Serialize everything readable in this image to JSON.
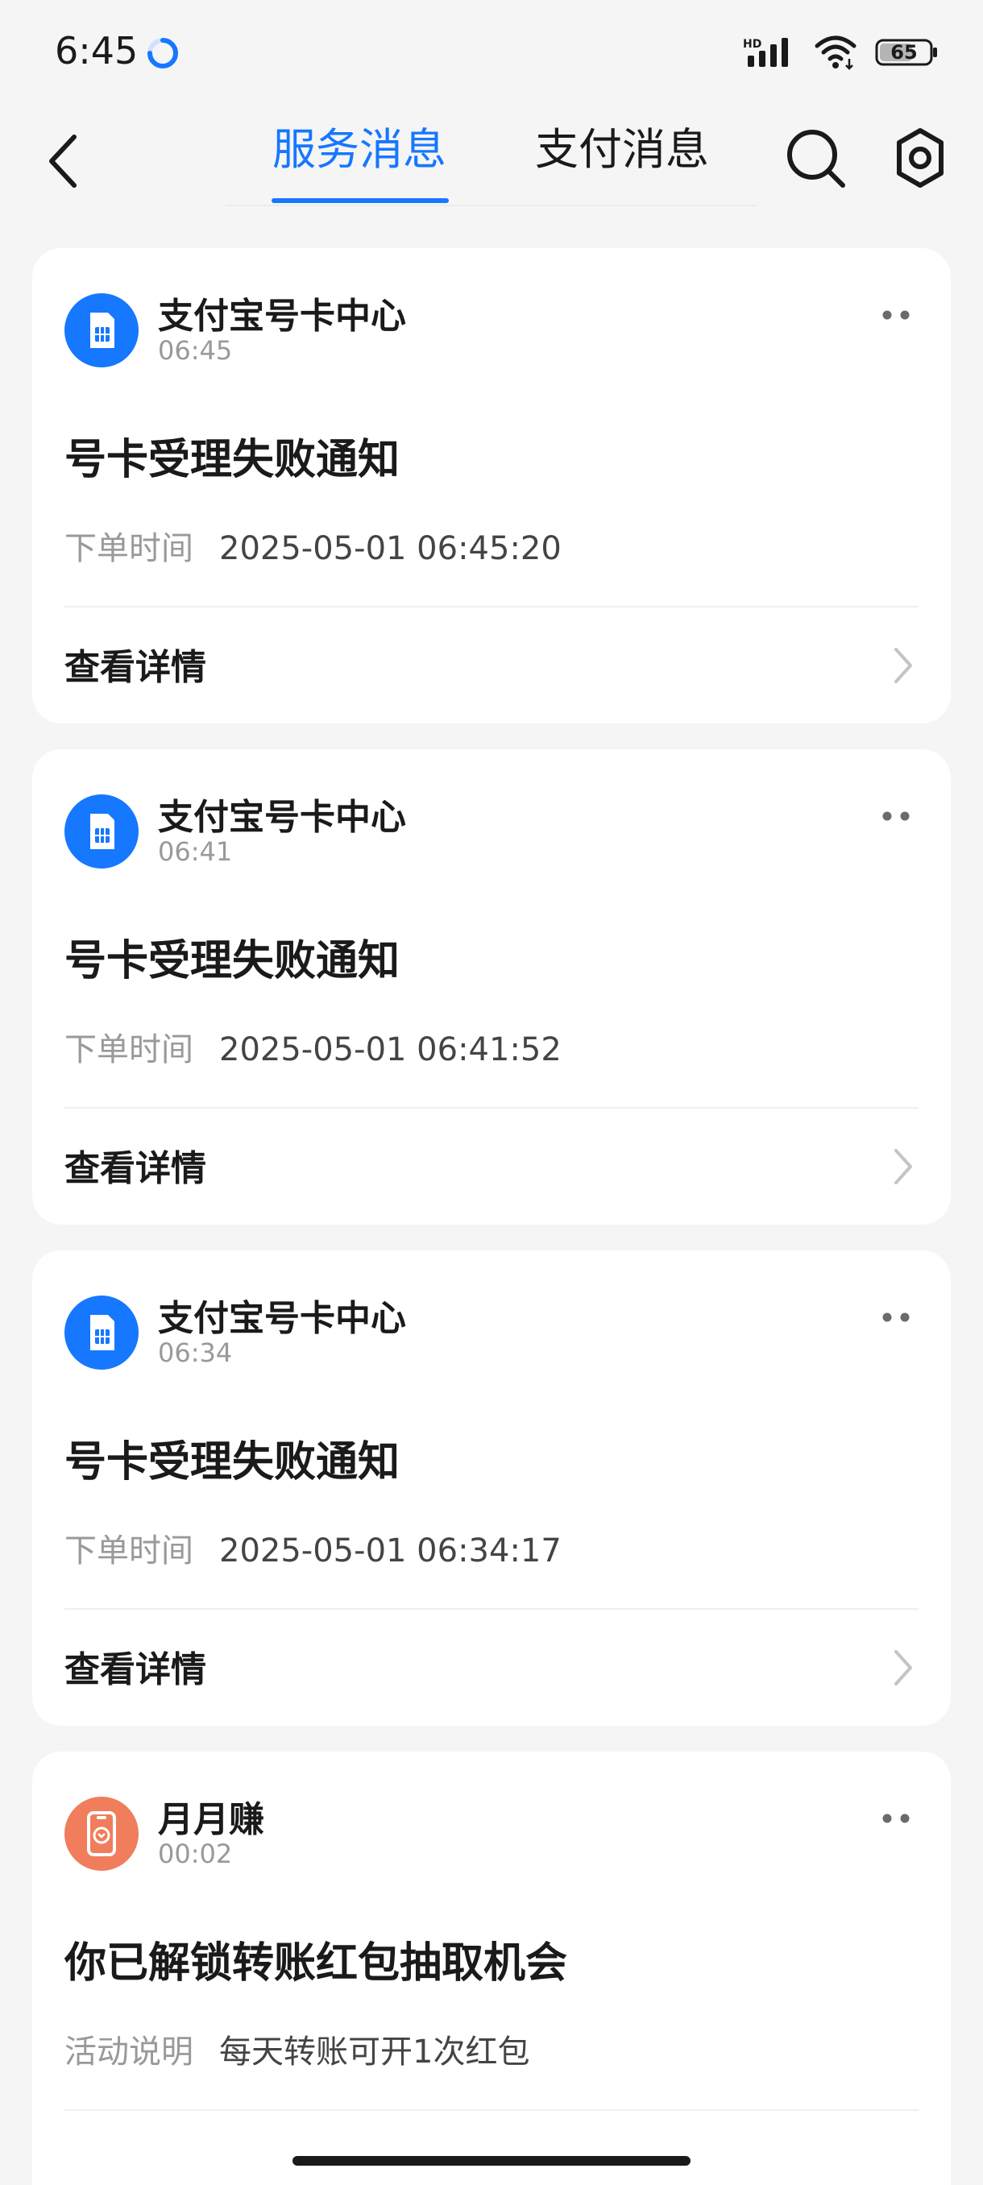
{
  "status_bar": {
    "time": "6:45",
    "network_label": "HD",
    "battery": "65"
  },
  "header": {
    "tabs": [
      {
        "label": "服务消息",
        "active": true
      },
      {
        "label": "支付消息",
        "active": false
      }
    ]
  },
  "messages": [
    {
      "sender": "支付宝号卡中心",
      "time": "06:45",
      "title": "号卡受理失败通知",
      "meta_label": "下单时间",
      "meta_value": "2025-05-01 06:45:20",
      "action": "查看详情",
      "icon": "sim-card-icon"
    },
    {
      "sender": "支付宝号卡中心",
      "time": "06:41",
      "title": "号卡受理失败通知",
      "meta_label": "下单时间",
      "meta_value": "2025-05-01 06:41:52",
      "action": "查看详情",
      "icon": "sim-card-icon"
    },
    {
      "sender": "支付宝号卡中心",
      "time": "06:34",
      "title": "号卡受理失败通知",
      "meta_label": "下单时间",
      "meta_value": "2025-05-01 06:34:17",
      "action": "查看详情",
      "icon": "sim-card-icon"
    },
    {
      "sender": "月月赚",
      "time": "00:02",
      "title": "你已解锁转账红包抽取机会",
      "meta_label": "活动说明",
      "meta_value": "每天转账可开1次红包",
      "icon": "phone-coin-icon"
    }
  ],
  "colors": {
    "accent": "#1677ff",
    "background": "#f5f5f5",
    "card": "#ffffff",
    "secondary_text": "#999999",
    "avatar_orange": "#f07d5c"
  }
}
